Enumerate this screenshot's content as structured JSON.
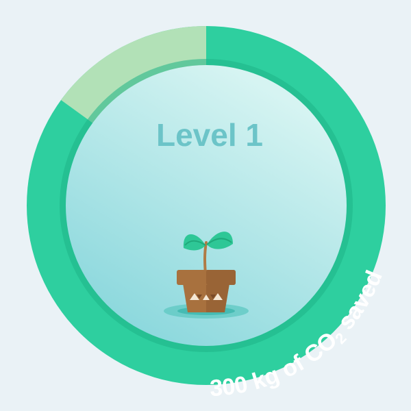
{
  "badge": {
    "level_label": "Level 1",
    "progress_fraction": 0.85,
    "saved": {
      "amount": "300 kg of CO",
      "subscript": "2",
      "suffix": " saved"
    }
  },
  "colors": {
    "background": "#eaf2f6",
    "ring": "#2ecf9f",
    "ring_remaining": "#b2e1b7",
    "inner_rim": "#1fb486",
    "inner_fill_top": "#d6f4f2",
    "inner_fill_bottom": "#8cd8dd",
    "level_text": "#6cc4c8",
    "saved_text": "#ffffff",
    "pot": "#a8713e",
    "pot_dark": "#8d5a30",
    "leaf": "#2ec796",
    "stem": "#b07b45"
  },
  "icons": {
    "plant": "potted-seedling-icon"
  }
}
